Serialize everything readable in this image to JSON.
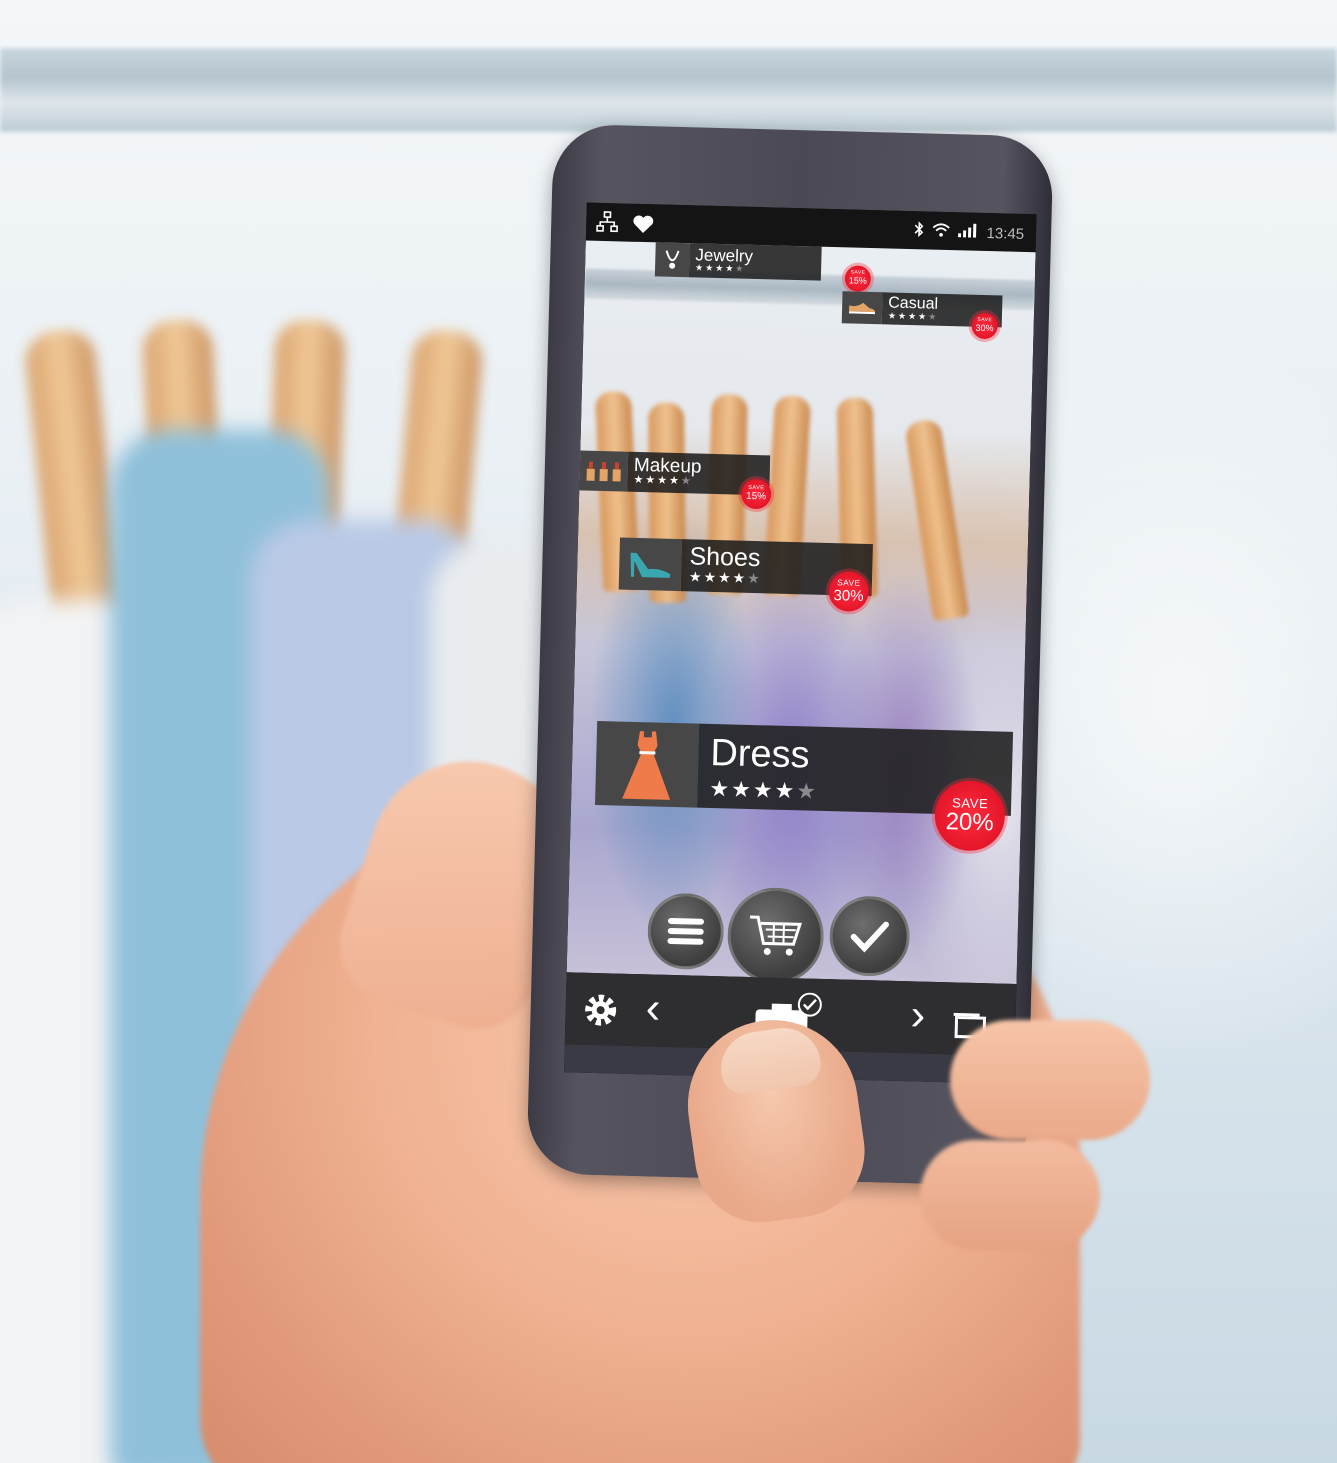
{
  "status_bar": {
    "left_icons": [
      "network-icon",
      "heart-icon"
    ],
    "right_icons": [
      "bluetooth-icon",
      "wifi-icon",
      "signal-icon"
    ],
    "time": "13:45"
  },
  "ar_tags": [
    {
      "id": "jewelry",
      "label": "Jewelry",
      "icon": "necklace-icon",
      "stars": "★★★★",
      "dim_star": "★",
      "badge_save": "SAVE",
      "badge_pct": "15%"
    },
    {
      "id": "casual",
      "label": "Casual",
      "icon": "shoe-icon",
      "stars": "★★★★",
      "dim_star": "★",
      "badge_save": "SAVE",
      "badge_pct": "30%"
    },
    {
      "id": "makeup",
      "label": "Makeup",
      "icon": "makeup-icon",
      "stars": "★★★★",
      "dim_star": "★",
      "badge_save": "SAVE",
      "badge_pct": "15%"
    },
    {
      "id": "shoes",
      "label": "Shoes",
      "icon": "high-heel-icon",
      "stars": "★★★★",
      "dim_star": "★",
      "badge_save": "SAVE",
      "badge_pct": "30%"
    },
    {
      "id": "dress",
      "label": "Dress",
      "icon": "dress-icon",
      "stars": "★★★★",
      "dim_star": "★",
      "badge_save": "SAVE",
      "badge_pct": "20%"
    }
  ],
  "controls": {
    "menu_icon": "menu-icon",
    "cart_icon": "cart-icon",
    "check_icon": "check-icon"
  },
  "nav": {
    "settings_icon": "gear-icon",
    "prev_glyph": "‹",
    "next_glyph": "›",
    "center_icon": "camera-check-icon",
    "window_icon": "window-icon"
  },
  "colors": {
    "badge_red": "#e5162a",
    "dress_orange": "#ef7a4a",
    "shoe_teal": "#3aa7b0",
    "tag_dark": "#1e1e1e"
  }
}
